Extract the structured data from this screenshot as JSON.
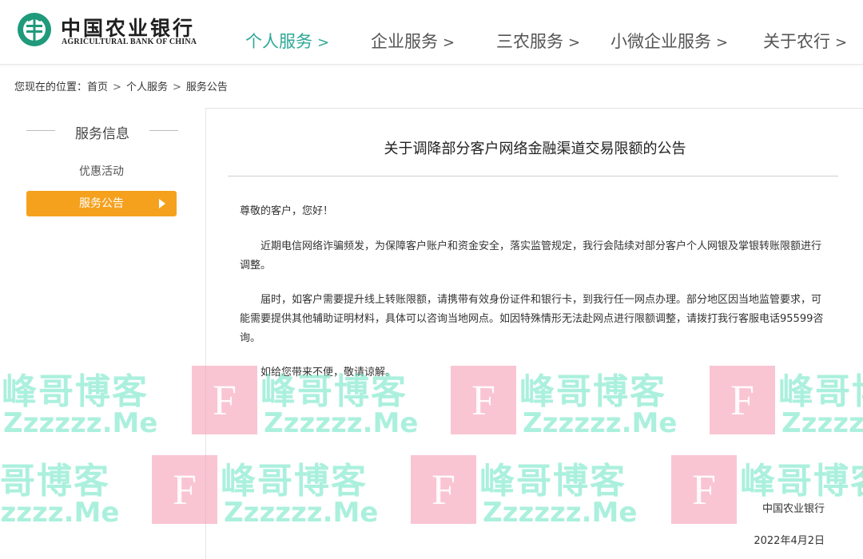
{
  "brand": {
    "name_cn": "中国农业银行",
    "name_en": "AGRICULTURAL BANK OF CHINA",
    "brand_color": "#1f9a7a"
  },
  "nav": {
    "items": [
      {
        "label": "个人服务",
        "active": true
      },
      {
        "label": "企业服务",
        "active": false
      },
      {
        "label": "三农服务",
        "active": false
      },
      {
        "label": "小微企业服务",
        "active": false
      },
      {
        "label": "关于农行",
        "active": false
      }
    ],
    "chevron": ">"
  },
  "breadcrumb": {
    "prefix": "您现在的位置：",
    "items": [
      "首页",
      "个人服务",
      "服务公告"
    ],
    "separator": ">"
  },
  "sidebar": {
    "title": "服务信息",
    "items": [
      {
        "label": "优惠活动",
        "active": false
      },
      {
        "label": "服务公告",
        "active": true
      }
    ],
    "active_color": "#f5a11e"
  },
  "article": {
    "title": "关于调降部分客户网络金融渠道交易限额的公告",
    "greeting": "尊敬的客户，您好！",
    "paragraphs": [
      "近期电信网络诈骗频发，为保障客户账户和资金安全，落实监管规定，我行会陆续对部分客户个人网银及掌银转账限额进行调整。",
      "届时，如客户需要提升线上转账限额，请携带有效身份证件和银行卡，到我行任一网点办理。部分地区因当地监管要求，可能需要提供其他辅助证明材料，具体可以咨询当地网点。如因特殊情形无法赴网点进行限额调整，请拨打我行客服电话95599咨询。",
      "如给您带来不便，敬请谅解。"
    ],
    "signature": "中国农业银行",
    "date": "2022年4月2日"
  },
  "watermark": {
    "text_cn": "峰哥博客",
    "text_en": "Zzzzzz.Me",
    "badge_letter": "F",
    "cn_color": "#78e6c8",
    "badge_color": "#f496af"
  }
}
